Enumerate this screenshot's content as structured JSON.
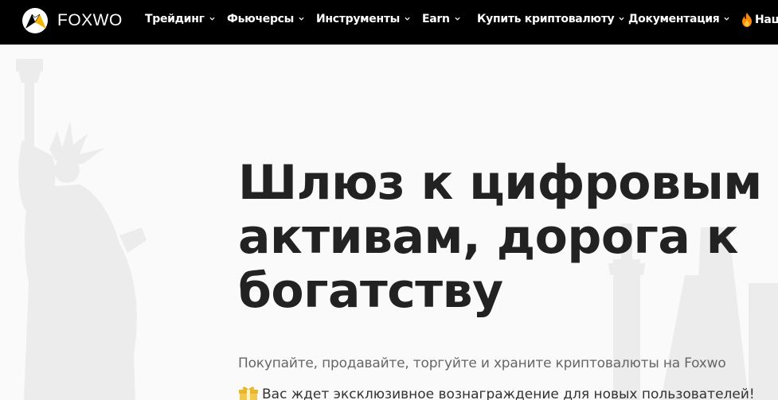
{
  "brand": {
    "name": "FOXWO",
    "logo_icon": "fox-logo-icon"
  },
  "nav": {
    "items": [
      {
        "label": "Трейдинг",
        "has_dropdown": true
      },
      {
        "label": "Фьючерсы",
        "has_dropdown": true
      },
      {
        "label": "Инструменты",
        "has_dropdown": true
      },
      {
        "label": "Earn",
        "has_dropdown": true
      },
      {
        "label": "Купить криптовалюту",
        "has_dropdown": true
      },
      {
        "label": "Документация",
        "has_dropdown": true
      },
      {
        "label": "Наш",
        "has_dropdown": false,
        "icon": "fire-icon"
      }
    ]
  },
  "hero": {
    "title": "Шлюз к цифровым активам, дорога к богатству",
    "subtitle": "Покупайте, продавайте, торгуйте и храните криптовалюты на Foxwo",
    "promo": "Вас ждет эксклюзивное вознаграждение для новых пользователей!",
    "promo_icon": "gift-icon"
  },
  "colors": {
    "navbar_bg": "#000000",
    "page_bg": "#fafafa",
    "title": "#222222",
    "subtitle": "#666666",
    "logo_accent": "#f7b500",
    "fire": "#ff8a00"
  }
}
